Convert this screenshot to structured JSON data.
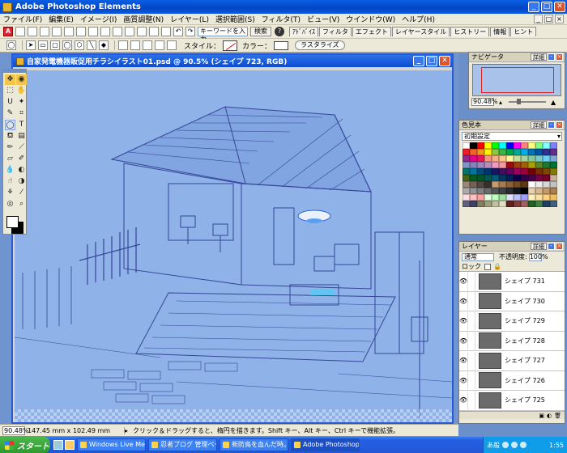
{
  "app": {
    "title": "Adobe Photoshop Elements"
  },
  "menu": [
    "ファイル(F)",
    "編集(E)",
    "イメージ(I)",
    "画質調整(N)",
    "レイヤー(L)",
    "選択範囲(S)",
    "フィルタ(T)",
    "ビュー(V)",
    "ウインドウ(W)",
    "ヘルプ(H)"
  ],
  "shortcuts": {
    "keyword_placeholder": "キーワードを入力",
    "search_label": "検索",
    "palette_tabs": [
      "ｱﾄﾞﾊﾞｲｽ",
      "フィルタ",
      "エフェクト",
      "レイヤースタイル",
      "ヒストリー",
      "情報",
      "ヒント"
    ]
  },
  "options": {
    "style_label": "スタイル：",
    "color_label": "カラー：",
    "rasterize_label": "ラスタライズ"
  },
  "document": {
    "title": "自家発電機器販促用チラシイラスト01.psd @ 90.5% (シェイプ 723, RGB)"
  },
  "status": {
    "zoom": "90.48%",
    "dimensions": "147.45 mm x 102.49 mm",
    "tip": "クリック＆ドラッグすると、楕円を描きます。Shift キー、Alt キー、Ctrl キーで機能拡張。"
  },
  "navigator": {
    "title": "ナビゲータ",
    "more": "詳細",
    "zoom": "90.48%"
  },
  "swatches": {
    "title": "色見本",
    "more": "詳細",
    "preset": "初期設定",
    "colors": [
      "#ffffff",
      "#000000",
      "#ff0000",
      "#ffff00",
      "#00ff00",
      "#00ffff",
      "#0000ff",
      "#ff00ff",
      "#ff8080",
      "#ffff80",
      "#80ff80",
      "#80ffff",
      "#8080ff",
      "#ed1c24",
      "#f26522",
      "#f7941d",
      "#fff200",
      "#8dc63f",
      "#39b54a",
      "#00a651",
      "#00a99d",
      "#00aeef",
      "#0072bc",
      "#0054a6",
      "#2e3192",
      "#662d91",
      "#92278f",
      "#ec008c",
      "#ed145b",
      "#f69679",
      "#f9ad81",
      "#fdc689",
      "#fff799",
      "#c4df9b",
      "#a3d39c",
      "#82ca9c",
      "#7accc8",
      "#6dcff6",
      "#7da7d9",
      "#8393ca",
      "#8781bd",
      "#a186be",
      "#bd8cbf",
      "#f49ac1",
      "#f6989d",
      "#9e0b0f",
      "#a0410d",
      "#a36209",
      "#aba000",
      "#598527",
      "#1a7b30",
      "#007236",
      "#00746b",
      "#0076a3",
      "#004b80",
      "#003471",
      "#1b1464",
      "#440e62",
      "#630460",
      "#9e005d",
      "#9e0039",
      "#790000",
      "#7b2e00",
      "#7d4900",
      "#827b00",
      "#406618",
      "#005e20",
      "#005826",
      "#005952",
      "#005b7f",
      "#003663",
      "#002157",
      "#0d004c",
      "#32004b",
      "#4b0049",
      "#7b0046",
      "#7a0026",
      "#c7b299",
      "#998675",
      "#736357",
      "#534741",
      "#37302a",
      "#c69c6d",
      "#a67c52",
      "#8c6239",
      "#754c24",
      "#603913",
      "#ffffff",
      "#ebebeb",
      "#d7d7d7",
      "#c2c2c2",
      "#ababab",
      "#959595",
      "#808080",
      "#6b6b6b",
      "#555555",
      "#404040",
      "#2b2b2b",
      "#151515",
      "#000000",
      "#e6d0b0",
      "#d6b98c",
      "#c49a6c",
      "#a88050",
      "#ffe0e0",
      "#ffc0c0",
      "#ffa0a0",
      "#e0ffe0",
      "#c0ffc0",
      "#a0e0a0",
      "#e0e0ff",
      "#c0c0ff",
      "#a0a0ff",
      "#fff0c0",
      "#ffe0a0",
      "#ffd080",
      "#f0c060",
      "#606080",
      "#404060",
      "#808060",
      "#a0a080",
      "#c0c0a0",
      "#e0e0c0",
      "#602020",
      "#804040",
      "#a06060",
      "#206020",
      "#408040",
      "#204060",
      "#406080"
    ]
  },
  "layers": {
    "title": "レイヤー",
    "more": "詳細",
    "mode": "通常",
    "opacity_label": "不透明度:",
    "opacity": "100%",
    "lock_label": "ロック",
    "items": [
      "シェイプ 731",
      "シェイプ 730",
      "シェイプ 729",
      "シェイプ 728",
      "シェイプ 727",
      "シェイプ 726",
      "シェイプ 725"
    ]
  },
  "taskbar": {
    "start": "スタート",
    "tasks": [
      "Windows Live Messe...",
      "忍者ブログ 管理ページ...",
      "新防鳥を血んだ時。...",
      "Adobe Photoshop Ele..."
    ],
    "tray_text": "あ般",
    "clock": "1:55"
  }
}
